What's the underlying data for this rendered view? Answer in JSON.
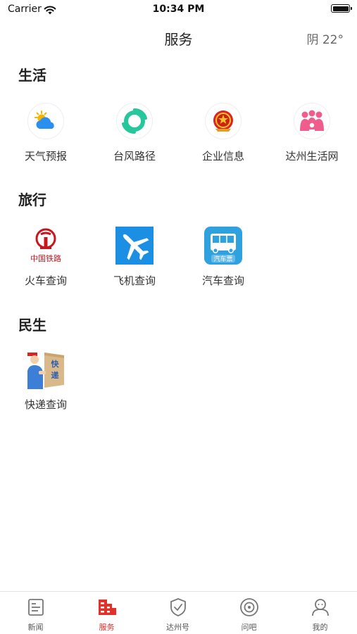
{
  "status_bar": {
    "carrier": "Carrier",
    "time": "10:34 PM"
  },
  "header": {
    "title": "服务",
    "weather": "阴 22°"
  },
  "sections": [
    {
      "title": "生活",
      "items": [
        {
          "label": "天气预报",
          "icon": "weather-icon"
        },
        {
          "label": "台风路径",
          "icon": "typhoon-icon"
        },
        {
          "label": "企业信息",
          "icon": "emblem-icon"
        },
        {
          "label": "达州生活网",
          "icon": "people-icon"
        }
      ]
    },
    {
      "title": "旅行",
      "items": [
        {
          "label": "火车查询",
          "icon": "railway-icon",
          "logo_text": "中国铁路"
        },
        {
          "label": "飞机查询",
          "icon": "airplane-icon"
        },
        {
          "label": "汽车查询",
          "icon": "bus-icon",
          "logo_text": "汽车票"
        }
      ]
    },
    {
      "title": "民生",
      "items": [
        {
          "label": "快递查询",
          "icon": "courier-icon",
          "logo_text": "快递"
        }
      ]
    }
  ],
  "tabbar": {
    "active_color": "#e0312a",
    "tabs": [
      {
        "label": "新闻",
        "icon": "news-icon"
      },
      {
        "label": "服务",
        "icon": "service-icon",
        "active": true
      },
      {
        "label": "达州号",
        "icon": "check-circle-icon"
      },
      {
        "label": "问吧",
        "icon": "qa-icon"
      },
      {
        "label": "我的",
        "icon": "profile-icon"
      }
    ]
  }
}
